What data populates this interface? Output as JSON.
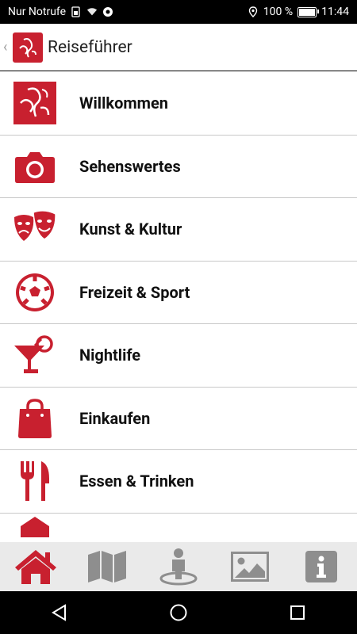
{
  "status_bar": {
    "carrier": "Nur Notrufe",
    "battery": "100 %",
    "time": "11:44"
  },
  "app_bar": {
    "title": "Reiseführer"
  },
  "menu": {
    "items": [
      {
        "label": "Willkommen",
        "icon": "welcome-logo-icon"
      },
      {
        "label": "Sehenswertes",
        "icon": "camera-icon"
      },
      {
        "label": "Kunst & Kultur",
        "icon": "theater-masks-icon"
      },
      {
        "label": "Freizeit & Sport",
        "icon": "soccer-ball-icon"
      },
      {
        "label": "Nightlife",
        "icon": "cocktail-glass-icon"
      },
      {
        "label": "Einkaufen",
        "icon": "shopping-bag-icon"
      },
      {
        "label": "Essen & Trinken",
        "icon": "fork-knife-icon"
      }
    ]
  },
  "tab_bar": {
    "tabs": [
      {
        "name": "home",
        "icon": "home-icon",
        "active": true
      },
      {
        "name": "map",
        "icon": "map-icon",
        "active": false
      },
      {
        "name": "location",
        "icon": "person-location-icon",
        "active": false
      },
      {
        "name": "gallery",
        "icon": "image-icon",
        "active": false
      },
      {
        "name": "info",
        "icon": "info-icon",
        "active": false
      }
    ]
  },
  "colors": {
    "accent": "#c8202f",
    "inactive_icon": "#8e8e8e",
    "tab_bar_bg": "#eaeaea"
  }
}
